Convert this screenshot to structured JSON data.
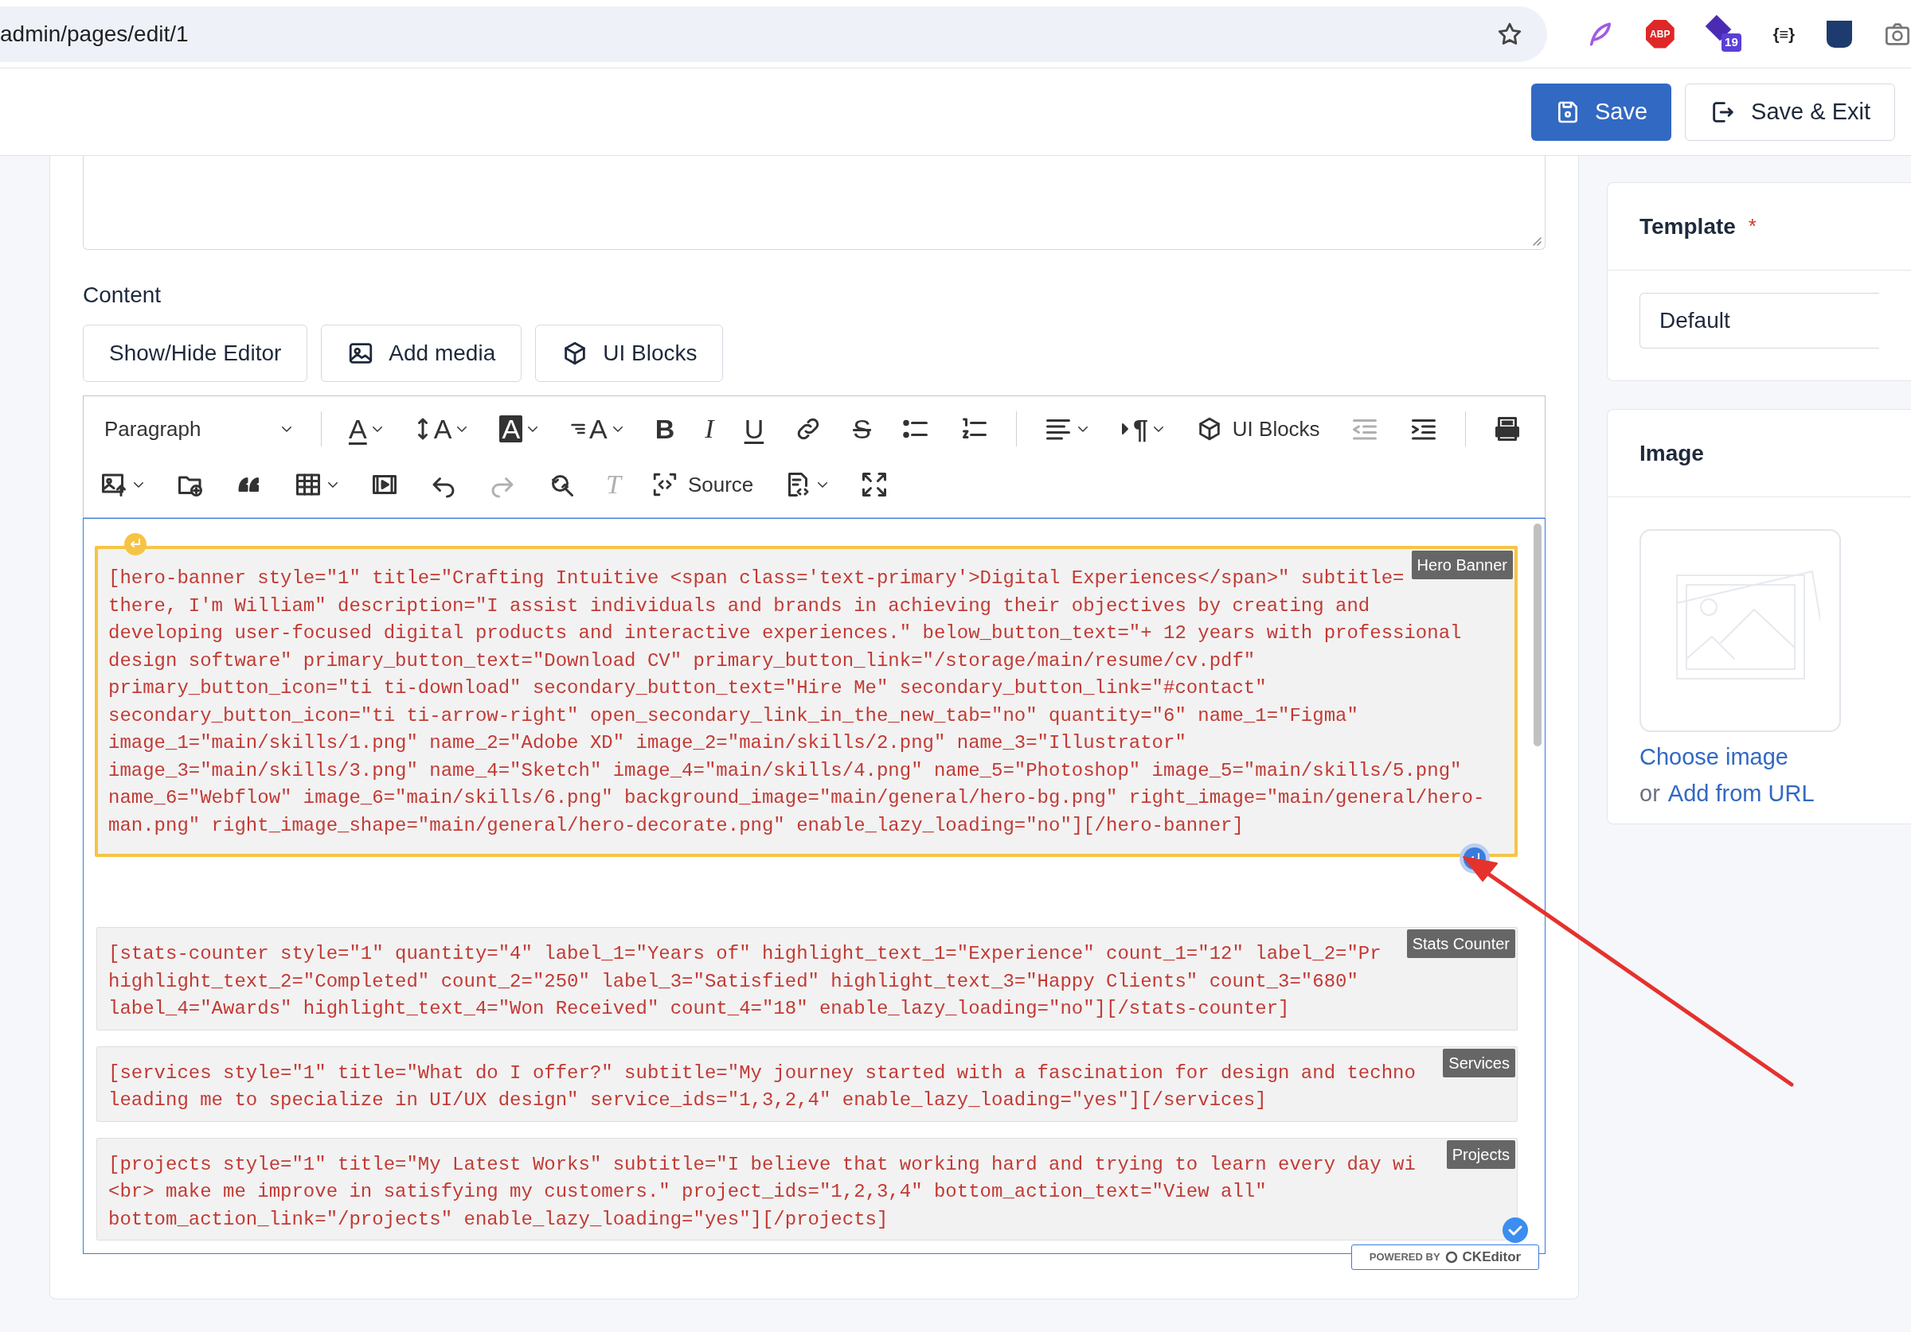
{
  "browser": {
    "address": "admin/pages/edit/1",
    "extensions": [
      {
        "kind": "feather"
      },
      {
        "kind": "adblock",
        "text": "ABP"
      },
      {
        "kind": "cap",
        "badge": "19"
      },
      {
        "kind": "braces",
        "text": "{≡}"
      },
      {
        "kind": "shield"
      },
      {
        "kind": "camera"
      }
    ]
  },
  "header": {
    "buttons": [
      {
        "label": "Save",
        "primary": true
      },
      {
        "label": "Save & Exit",
        "primary": false
      }
    ]
  },
  "content": {
    "label": "Content",
    "buttons": [
      "Show/Hide Editor",
      "Add media",
      "UI Blocks"
    ]
  },
  "toolbar": {
    "rows": [
      [
        {
          "kind": "dropdown",
          "label": "Paragraph",
          "disabled": false
        },
        {
          "kind": "separator"
        },
        {
          "kind": "glyph",
          "glyph": "A",
          "caret": true,
          "disabled": false
        },
        {
          "kind": "glyph",
          "glyph": "A",
          "caret": true,
          "disabled": false
        },
        {
          "kind": "glyph",
          "glyph": "A",
          "caret": true,
          "disabled": false
        },
        {
          "kind": "glyph",
          "glyph": "A",
          "caret": true,
          "disabled": false
        },
        {
          "kind": "glyph",
          "glyph": "B",
          "caret": false,
          "disabled": false
        },
        {
          "kind": "glyph",
          "glyph": "I",
          "caret": false,
          "disabled": false
        },
        {
          "kind": "glyph",
          "glyph": "U",
          "caret": false,
          "disabled": false
        },
        {
          "kind": "icon",
          "caret": false,
          "disabled": false
        },
        {
          "kind": "glyph",
          "glyph": "S",
          "caret": false,
          "disabled": false
        },
        {
          "kind": "icon",
          "caret": false,
          "disabled": false
        },
        {
          "kind": "icon",
          "caret": false,
          "disabled": false
        },
        {
          "kind": "separator"
        },
        {
          "kind": "icon",
          "caret": true,
          "disabled": false
        },
        {
          "kind": "glyph",
          "glyph": "¶",
          "caret": true,
          "disabled": false
        },
        {
          "kind": "labeled",
          "label": "UI Blocks",
          "disabled": false
        },
        {
          "kind": "icon",
          "caret": false,
          "disabled": true
        },
        {
          "kind": "icon",
          "caret": false,
          "disabled": false
        },
        {
          "kind": "separator"
        },
        {
          "kind": "icon",
          "caret": false,
          "disabled": false
        }
      ],
      [
        {
          "kind": "icon",
          "caret": true,
          "disabled": false
        },
        {
          "kind": "icon",
          "caret": false,
          "disabled": false
        },
        {
          "kind": "icon",
          "caret": false,
          "disabled": false
        },
        {
          "kind": "icon",
          "caret": true,
          "disabled": false
        },
        {
          "kind": "icon",
          "caret": false,
          "disabled": false
        },
        {
          "kind": "icon",
          "caret": false,
          "disabled": false
        },
        {
          "kind": "icon",
          "caret": false,
          "disabled": true
        },
        {
          "kind": "icon",
          "caret": false,
          "disabled": false
        },
        {
          "kind": "glyph",
          "glyph": "T",
          "caret": false,
          "disabled": true
        },
        {
          "kind": "labeled",
          "label": "Source",
          "disabled": false
        },
        {
          "kind": "icon",
          "caret": true,
          "disabled": false
        },
        {
          "kind": "icon",
          "caret": false,
          "disabled": false
        }
      ]
    ]
  },
  "widgets": [
    {
      "label": "Hero Banner",
      "selected": true,
      "lines": [
        "[hero-banner style=\"1\" title=\"Crafting Intuitive <span class='text-primary'>Digital Experiences</span>\" subtitle=",
        "there, I'm William\" description=\"I assist individuals and brands in achieving their objectives by creating and",
        "developing user-focused digital products and interactive experiences.\" below_button_text=\"+ 12 years with professional",
        "design software\" primary_button_text=\"Download CV\" primary_button_link=\"/storage/main/resume/cv.pdf\"",
        "primary_button_icon=\"ti ti-download\" secondary_button_text=\"Hire Me\" secondary_button_link=\"#contact\"",
        "secondary_button_icon=\"ti ti-arrow-right\" open_secondary_link_in_the_new_tab=\"no\" quantity=\"6\" name_1=\"Figma\"",
        "image_1=\"main/skills/1.png\" name_2=\"Adobe XD\" image_2=\"main/skills/2.png\" name_3=\"Illustrator\"",
        "image_3=\"main/skills/3.png\" name_4=\"Sketch\" image_4=\"main/skills/4.png\" name_5=\"Photoshop\" image_5=\"main/skills/5.png\"",
        "name_6=\"Webflow\" image_6=\"main/skills/6.png\" background_image=\"main/general/hero-bg.png\" right_image=\"main/general/hero-",
        "man.png\" right_image_shape=\"main/general/hero-decorate.png\" enable_lazy_loading=\"no\"][/hero-banner]"
      ]
    },
    {
      "label": "Stats Counter",
      "selected": false,
      "lines": [
        "[stats-counter style=\"1\" quantity=\"4\" label_1=\"Years of\" highlight_text_1=\"Experience\" count_1=\"12\" label_2=\"Pr",
        "highlight_text_2=\"Completed\" count_2=\"250\" label_3=\"Satisfied\" highlight_text_3=\"Happy Clients\" count_3=\"680\"",
        "label_4=\"Awards\" highlight_text_4=\"Won Received\" count_4=\"18\" enable_lazy_loading=\"no\"][/stats-counter]"
      ]
    },
    {
      "label": "Services",
      "selected": false,
      "lines": [
        "[services style=\"1\" title=\"What do I offer?\" subtitle=\"My journey started with a fascination for design and techno",
        "leading me to specialize in UI/UX design\" service_ids=\"1,3,2,4\" enable_lazy_loading=\"yes\"][/services]"
      ]
    },
    {
      "label": "Projects",
      "selected": false,
      "lines": [
        "[projects style=\"1\" title=\"My Latest Works\" subtitle=\"I believe that working hard and trying to learn every day wi",
        "<br> make me improve in satisfying my customers.\" project_ids=\"1,2,3,4\" bottom_action_text=\"View all\"",
        "bottom_action_link=\"/projects\" enable_lazy_loading=\"yes\"][/projects]"
      ]
    }
  ],
  "powered_by": {
    "prefix": "POWERED BY",
    "brand": "CKEditor"
  },
  "sidebar": {
    "template": {
      "title": "Template",
      "required_mark": "*",
      "value": "Default"
    },
    "image": {
      "title": "Image",
      "choose": "Choose image",
      "or": "or",
      "add_url": "Add from URL"
    }
  }
}
